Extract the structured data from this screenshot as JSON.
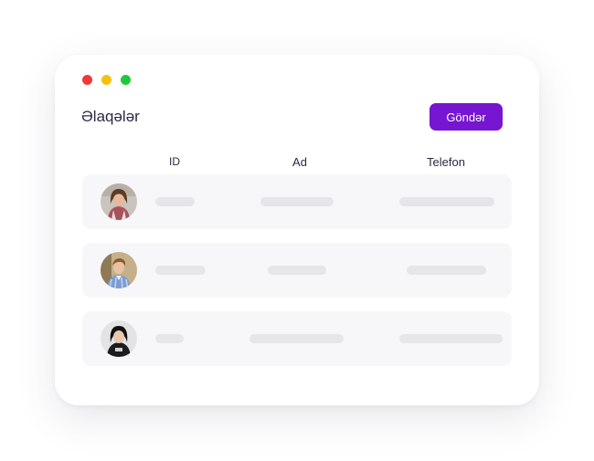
{
  "window": {
    "dots": [
      "#f03a35",
      "#f7c00e",
      "#21c93a"
    ]
  },
  "header": {
    "title": "Əlaqələr",
    "send_button": "Göndər",
    "accent": "#7716d1"
  },
  "table": {
    "columns": [
      "ID",
      "Ad",
      "Telefon"
    ],
    "rows": [
      {
        "avatar": "avatar-woman-plaid-shirt"
      },
      {
        "avatar": "avatar-man-checkered-shirt"
      },
      {
        "avatar": "avatar-woman-black-tshirt"
      }
    ]
  }
}
